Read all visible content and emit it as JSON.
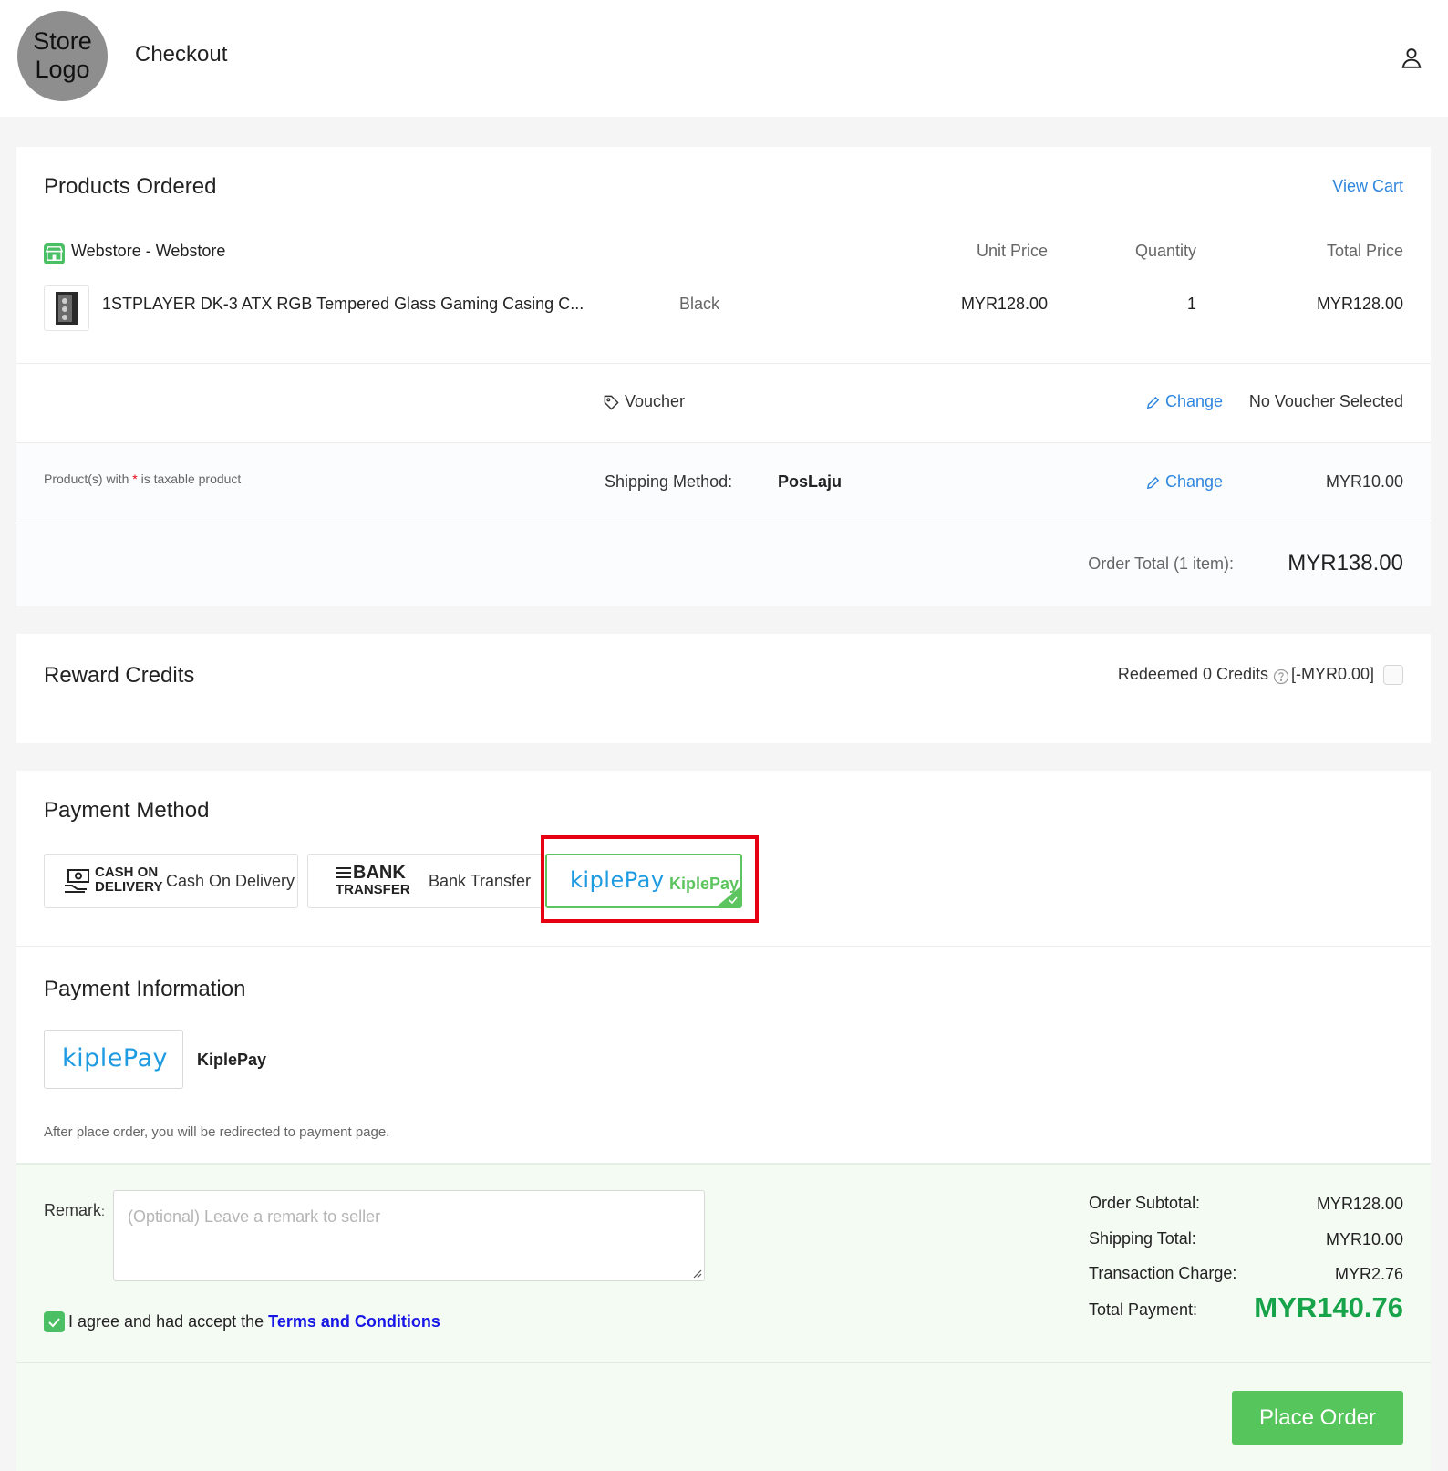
{
  "header": {
    "logo_text": "Store Logo",
    "title": "Checkout"
  },
  "products": {
    "title": "Products Ordered",
    "view_cart": "View Cart",
    "store_name": "Webstore - Webstore",
    "columns": {
      "unit_price": "Unit Price",
      "quantity": "Quantity",
      "total_price": "Total Price"
    },
    "items": [
      {
        "name": "1STPLAYER DK-3 ATX RGB Tempered Glass Gaming Casing C...",
        "variant": "Black",
        "unit_price": "MYR128.00",
        "quantity": "1",
        "total_price": "MYR128.00"
      }
    ],
    "voucher_label": "Voucher",
    "voucher_change": "Change",
    "voucher_value": "No Voucher Selected",
    "taxable_prefix": "Product(s) with ",
    "taxable_star": "*",
    "taxable_suffix": " is taxable product",
    "shipping_label": "Shipping Method:",
    "shipping_method": "PosLaju",
    "shipping_change": "Change",
    "shipping_fee": "MYR10.00",
    "order_total_label": "Order Total (1 item):",
    "order_total": "MYR138.00"
  },
  "rewards": {
    "title": "Reward Credits",
    "redeemed": "Redeemed 0 Credits",
    "value": "[-MYR0.00]"
  },
  "payment": {
    "title": "Payment Method",
    "options": [
      {
        "logo_line1": "CASH ON",
        "logo_line2": "DELIVERY",
        "label": "Cash On Delivery"
      },
      {
        "logo_line1": "BANK",
        "logo_line2": "TRANSFER",
        "label": "Bank Transfer"
      },
      {
        "logo": "kiplePay",
        "label": "KiplePay",
        "selected": true
      }
    ]
  },
  "payment_info": {
    "title": "Payment Information",
    "logo": "kiplePay",
    "method": "KiplePay",
    "note": "After place order, you will be redirected to payment page."
  },
  "summary": {
    "remark_label": "Remark",
    "remark_sep": ":",
    "remark_placeholder": "(Optional) Leave a remark to seller",
    "agree_text": "I agree and had accept the ",
    "terms_link": "Terms and Conditions",
    "subtotal_label": "Order Subtotal:",
    "subtotal": "MYR128.00",
    "shipping_total_label": "Shipping Total:",
    "shipping_total": "MYR10.00",
    "transaction_label": "Transaction Charge:",
    "transaction": "MYR2.76",
    "total_payment_label": "Total Payment:",
    "total_payment": "MYR140.76",
    "place_order": "Place Order"
  },
  "colors": {
    "accent_green": "#4bbf63",
    "link_blue": "#2f86de",
    "total_green": "#17a34a",
    "highlight_red": "#e60012"
  }
}
